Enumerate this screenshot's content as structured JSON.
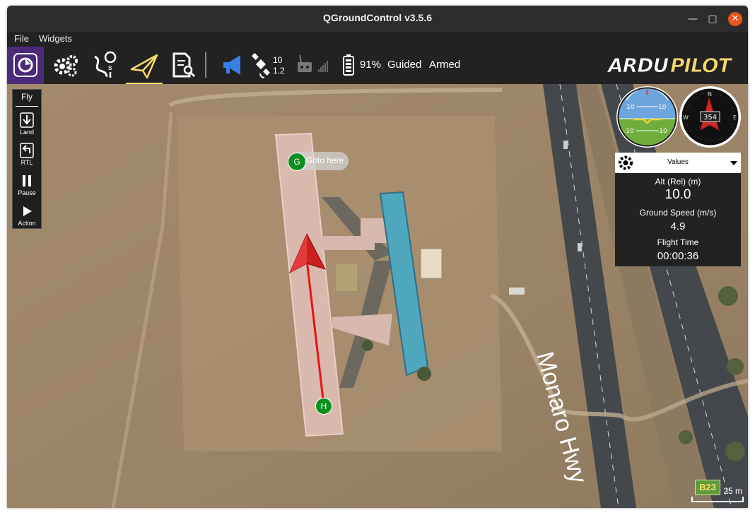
{
  "window": {
    "title": "QGroundControl v3.5.6",
    "minimize_glyph": "—",
    "maximize_glyph": "□",
    "close_glyph": "✕"
  },
  "menu": {
    "items": [
      "File",
      "Widgets"
    ]
  },
  "toolbar": {
    "icons": [
      "qgc-logo-icon",
      "vehicle-setup-gear-icon",
      "plan-route-icon",
      "fly-paper-plane-icon",
      "analyze-document-icon"
    ],
    "messages_icon": "megaphone-icon",
    "gps": {
      "satellites": "10",
      "hdop": "1.2"
    },
    "rc_icon": "rc-transmitter-icon",
    "battery": {
      "percent": "91%"
    },
    "flight_mode": "Guided",
    "arm_state": "Armed",
    "brand": "ARDUPILOT",
    "accent_color": "#f7d96b"
  },
  "fly_panel": {
    "header": "Fly",
    "items": [
      {
        "label": "Land",
        "icon": "land-arrow-icon"
      },
      {
        "label": "RTL",
        "icon": "rtl-return-icon"
      },
      {
        "label": "Pause",
        "icon": "pause-icon"
      },
      {
        "label": "Action",
        "icon": "play-action-icon"
      }
    ]
  },
  "map": {
    "goto_marker": {
      "letter": "G",
      "label": "Goto here"
    },
    "home_marker": {
      "letter": "H"
    },
    "road_label": "Monaro Hwy",
    "road_sign": "B23",
    "scale": "25 m"
  },
  "instruments": {
    "attitude": {
      "pitch_marks": [
        "10",
        "10",
        "-10",
        "-10"
      ]
    },
    "compass": {
      "heading": "354",
      "cardinals": [
        "N",
        "E",
        "W"
      ]
    }
  },
  "values_panel": {
    "header": "Values",
    "items": [
      {
        "label": "Alt (Rel) (m)",
        "value": "10.0"
      },
      {
        "label": "Ground Speed (m/s)",
        "value": "4.9"
      },
      {
        "label": "Flight Time",
        "value": "00:00:36"
      }
    ]
  }
}
